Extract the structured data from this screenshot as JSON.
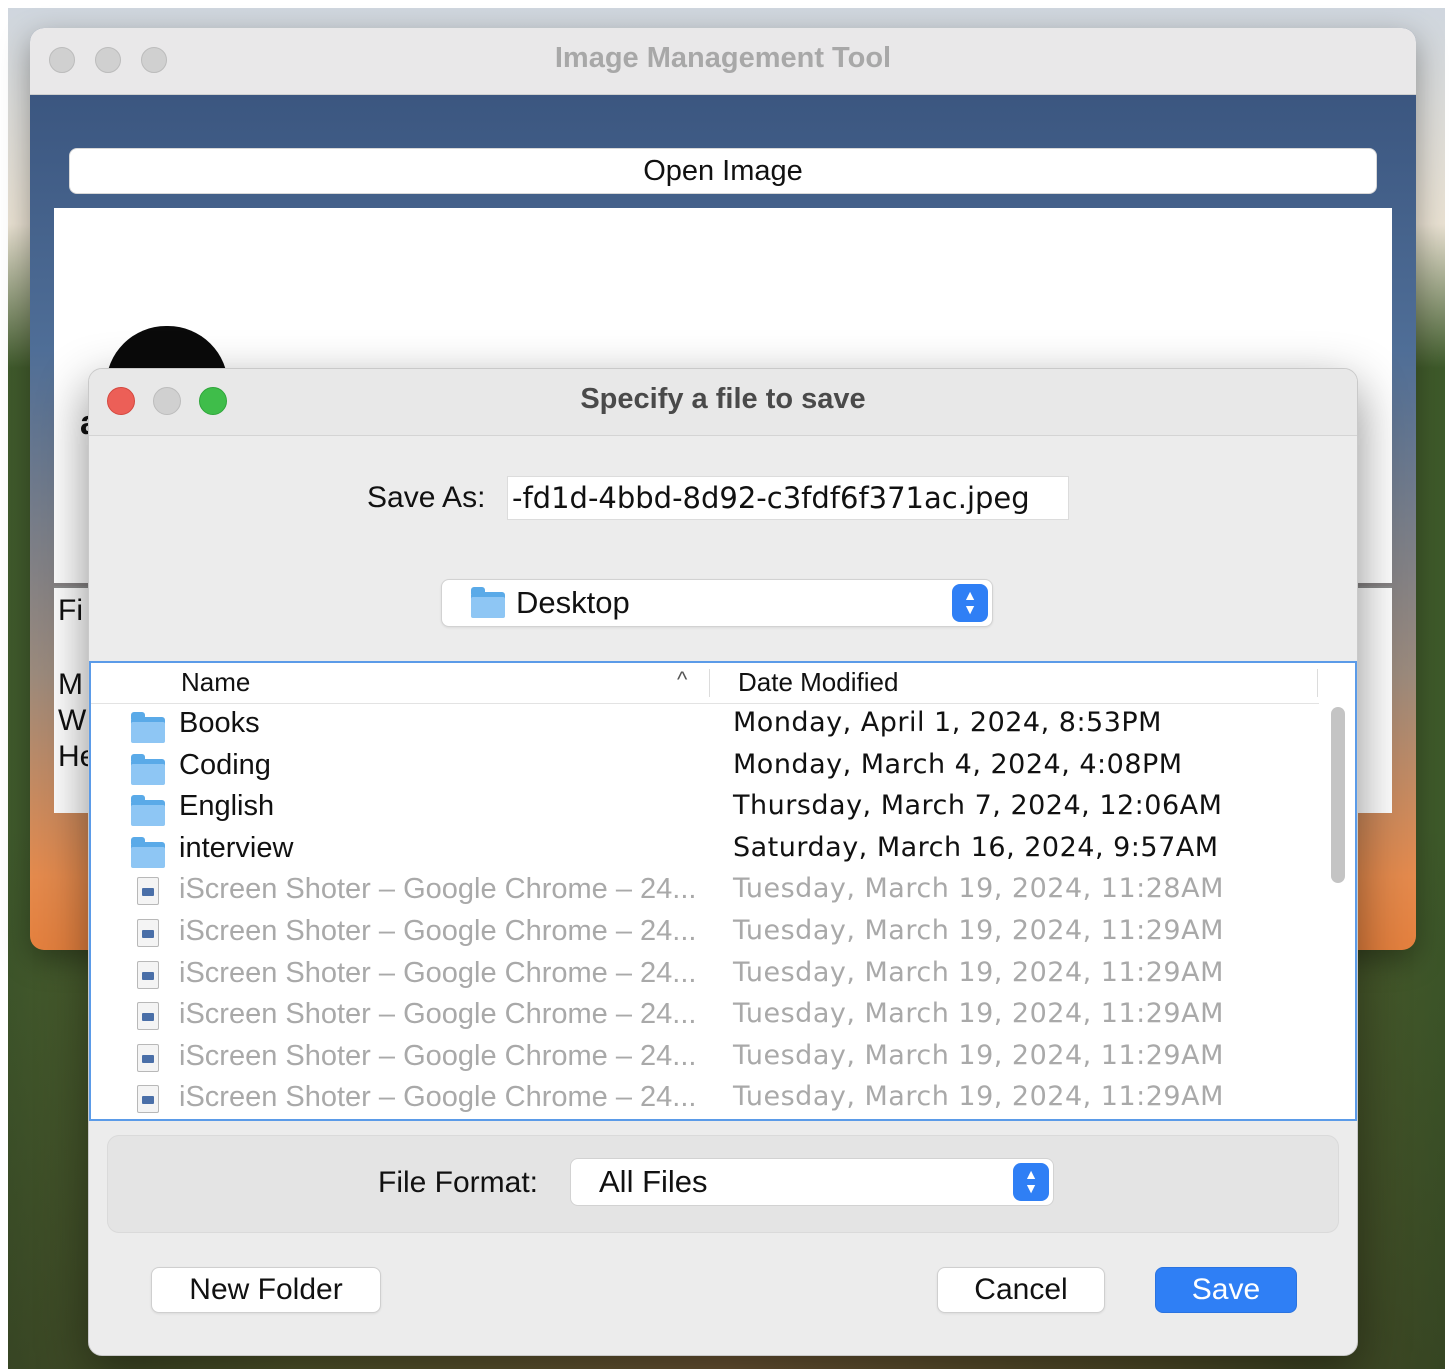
{
  "main_window": {
    "title": "Image Management Tool",
    "open_image_label": "Open Image",
    "info_lines": [
      "Fi",
      "M",
      "Wi",
      "He"
    ],
    "canvas_glyph": "a"
  },
  "dialog": {
    "title": "Specify a file to save",
    "save_as_label": "Save As:",
    "save_as_value": "-fd1d-4bbd-8d92-c3fdf6f371ac.jpeg",
    "location": "Desktop",
    "columns": {
      "name": "Name",
      "date": "Date Modified",
      "sort_indicator": "^"
    },
    "rows": [
      {
        "name": "Books",
        "date": "Monday, April 1, 2024, 8:53PM",
        "type": "folder",
        "enabled": true
      },
      {
        "name": "Coding",
        "date": "Monday, March 4, 2024, 4:08PM",
        "type": "folder",
        "enabled": true
      },
      {
        "name": "English",
        "date": "Thursday, March 7, 2024, 12:06AM",
        "type": "folder",
        "enabled": true
      },
      {
        "name": "interview",
        "date": "Saturday, March 16, 2024, 9:57AM",
        "type": "folder",
        "enabled": true
      },
      {
        "name": "iScreen Shoter – Google Chrome – 24...",
        "date": "Tuesday, March 19, 2024, 11:28AM",
        "type": "file",
        "enabled": false
      },
      {
        "name": "iScreen Shoter – Google Chrome – 24...",
        "date": "Tuesday, March 19, 2024, 11:29AM",
        "type": "file",
        "enabled": false
      },
      {
        "name": "iScreen Shoter – Google Chrome – 24...",
        "date": "Tuesday, March 19, 2024, 11:29AM",
        "type": "file",
        "enabled": false
      },
      {
        "name": "iScreen Shoter – Google Chrome – 24...",
        "date": "Tuesday, March 19, 2024, 11:29AM",
        "type": "file",
        "enabled": false
      },
      {
        "name": "iScreen Shoter – Google Chrome – 24...",
        "date": "Tuesday, March 19, 2024, 11:29AM",
        "type": "file",
        "enabled": false
      },
      {
        "name": "iScreen Shoter – Google Chrome – 24...",
        "date": "Tuesday, March 19, 2024, 11:29AM",
        "type": "file",
        "enabled": false
      }
    ],
    "file_format_label": "File Format:",
    "file_format_value": "All Files",
    "new_folder_label": "New Folder",
    "cancel_label": "Cancel",
    "save_label": "Save"
  },
  "colors": {
    "accent": "#2f7ff5",
    "close_light": "#ec5f57",
    "minimize_light_inactive": "#d0d0d0",
    "zoom_light": "#3fbd4a",
    "disabled_text": "#a9a9a9",
    "list_border": "#5b9be8"
  },
  "icons": {
    "folder": "folder-icon",
    "file": "image-file-icon",
    "stepper": "up-down-chevron-icon"
  }
}
